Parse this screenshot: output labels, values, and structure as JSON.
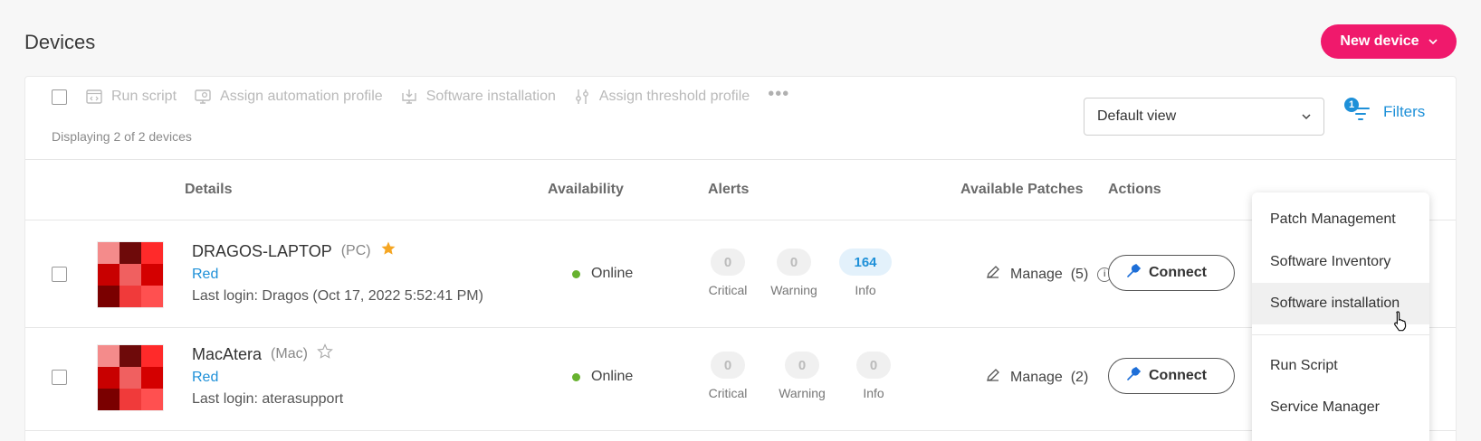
{
  "header": {
    "title": "Devices",
    "new_device_label": "New device"
  },
  "toolbar": {
    "actions": [
      {
        "label": "Run script",
        "icon": "code-window-icon"
      },
      {
        "label": "Assign automation profile",
        "icon": "monitor-gear-icon"
      },
      {
        "label": "Software installation",
        "icon": "download-monitor-icon"
      },
      {
        "label": "Assign threshold profile",
        "icon": "sliders-icon"
      }
    ],
    "more_label": "•••",
    "displaying": "Displaying 2 of 2 devices",
    "view_select": "Default view",
    "filters_label": "Filters",
    "filters_count": "1"
  },
  "table": {
    "headers": [
      "Details",
      "Availability",
      "Alerts",
      "Available Patches",
      "Actions"
    ],
    "rows": [
      {
        "name": "DRAGOS-LAPTOP",
        "type": "(PC)",
        "starred": true,
        "group": "Red",
        "last_login": "Last login: Dragos (Oct 17, 2022 5:52:41 PM)",
        "availability": "Online",
        "alerts": {
          "critical": "0",
          "warning": "0",
          "info": "164"
        },
        "alert_labels": {
          "critical": "Critical",
          "warning": "Warning",
          "info": "Info"
        },
        "patches": "Manage  (5)",
        "patches_info": true,
        "connect_label": "Connect"
      },
      {
        "name": "MacAtera",
        "type": "(Mac)",
        "starred": false,
        "group": "Red",
        "last_login": "Last login: aterasupport",
        "availability": "Online",
        "alerts": {
          "critical": "0",
          "warning": "0",
          "info": "0"
        },
        "alert_labels": {
          "critical": "Critical",
          "warning": "Warning",
          "info": "Info"
        },
        "patches": "Manage  (2)",
        "patches_info": false,
        "connect_label": "Connect"
      }
    ]
  },
  "dropdown_menu": {
    "items": [
      "Patch Management",
      "Software Inventory",
      "Software installation",
      "Run Script",
      "Service Manager"
    ],
    "hovered": "Software installation"
  },
  "colors": {
    "accent": "#f0196c",
    "link": "#1e90d8",
    "online": "#67b22f",
    "star": "#f5a623"
  }
}
